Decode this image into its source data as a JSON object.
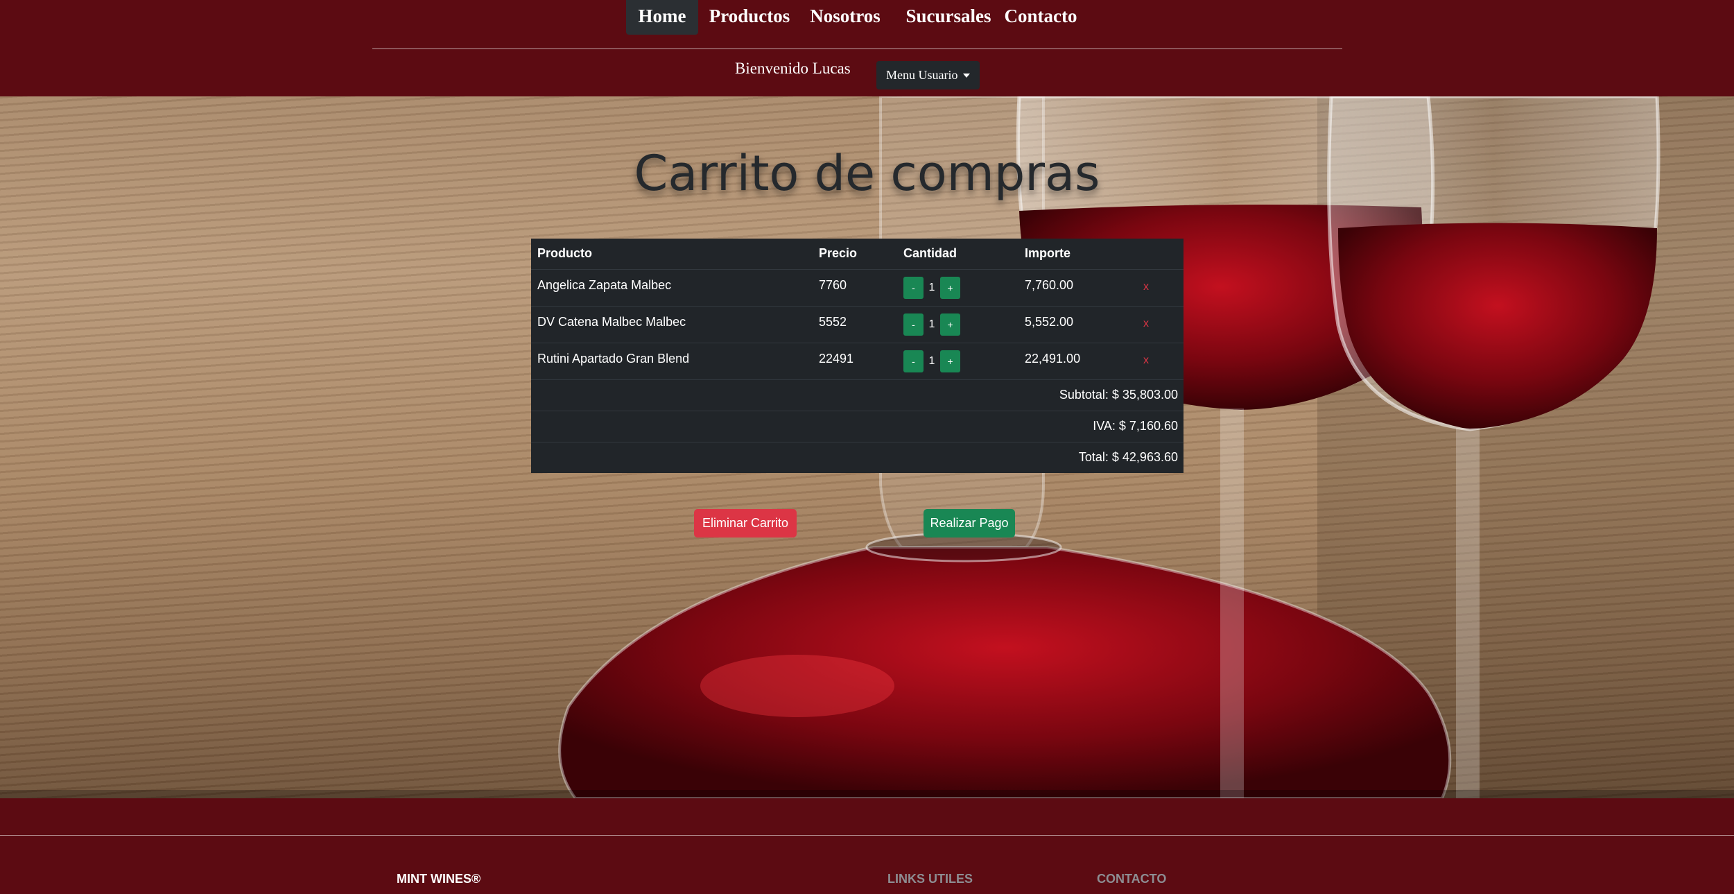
{
  "nav": {
    "items": [
      {
        "label": "Home",
        "active": true
      },
      {
        "label": "Productos"
      },
      {
        "label": "Nosotros"
      },
      {
        "label": "Sucursales"
      },
      {
        "label": "Contacto"
      }
    ]
  },
  "user": {
    "welcome": "Bienvenido Lucas",
    "menu_label": "Menu Usuario"
  },
  "page": {
    "title": "Carrito de compras"
  },
  "cart": {
    "headers": {
      "product": "Producto",
      "price": "Precio",
      "quantity": "Cantidad",
      "amount": "Importe"
    },
    "items": [
      {
        "product": "Angelica Zapata Malbec",
        "price": "7760",
        "quantity": "1",
        "amount": "7,760.00"
      },
      {
        "product": "DV Catena Malbec Malbec",
        "price": "5552",
        "quantity": "1",
        "amount": "5,552.00"
      },
      {
        "product": "Rutini Apartado Gran Blend",
        "price": "22491",
        "quantity": "1",
        "amount": "22,491.00"
      }
    ],
    "decrement_label": "-",
    "increment_label": "+",
    "remove_label": "x",
    "subtotal": "Subtotal: $ 35,803.00",
    "iva": "IVA: $ 7,160.60",
    "total": "Total: $ 42,963.60"
  },
  "actions": {
    "empty_cart": "Eliminar Carrito",
    "pay": "Realizar Pago"
  },
  "footer": {
    "brand": "MINT WINES®",
    "links_heading": "LINKS UTILES",
    "contact_heading": "CONTACTO"
  },
  "colors": {
    "header_bg": "#5c0b12",
    "table_bg": "#212529",
    "success": "#198754",
    "danger": "#dc3545"
  }
}
